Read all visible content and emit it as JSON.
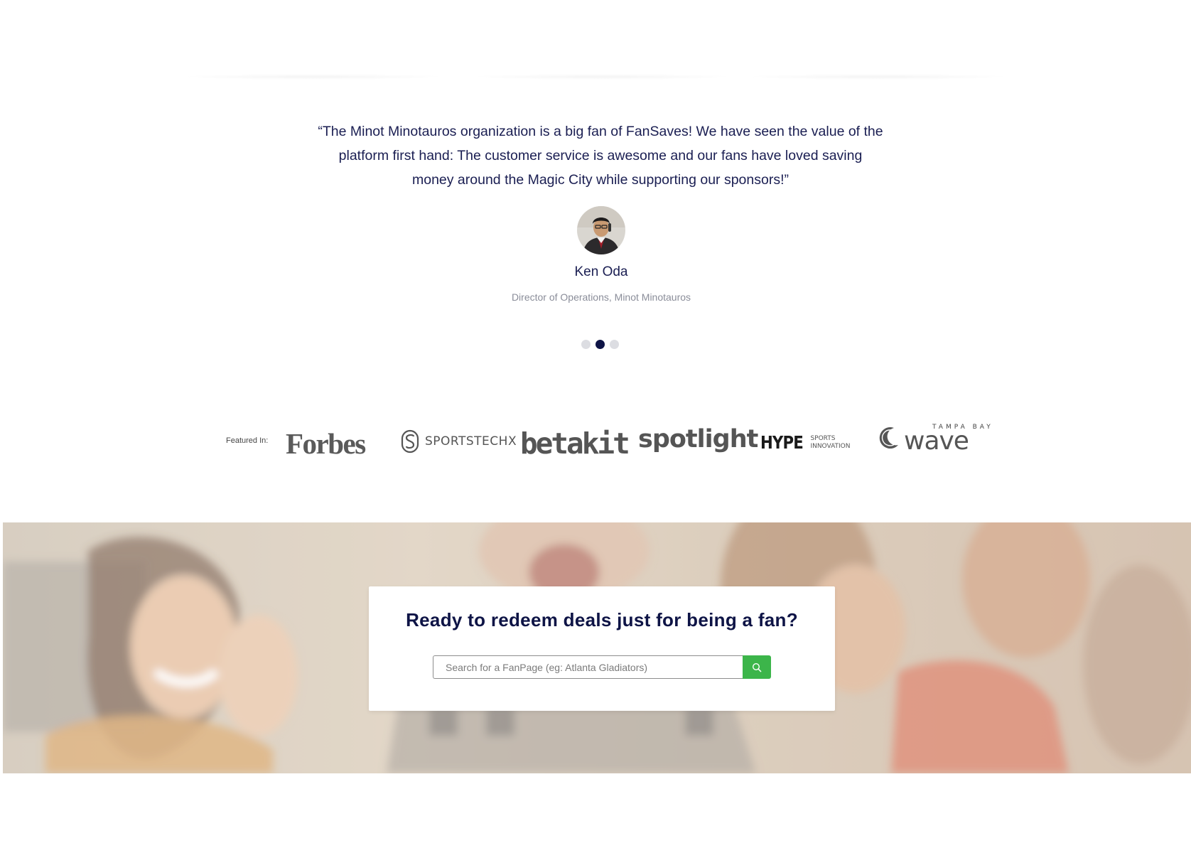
{
  "testimonial": {
    "quote": "“The Minot Minotauros organization is a big fan of FanSaves! We have seen the value of the platform first hand: The customer service is awesome and our fans have loved saving money around the Magic City while supporting our sponsors!”",
    "author_name": "Ken Oda",
    "author_role": "Director of Operations, Minot Minotauros",
    "carousel": {
      "count": 3,
      "active_index": 1
    }
  },
  "featured": {
    "label": "Featured In:",
    "logos": {
      "forbes": "Forbes",
      "sportstechx": "SPORTSTECHX",
      "betakit": "betakit",
      "spotlight": "spotlight",
      "hype_main": "HYPE",
      "hype_sub_1": "SPORTS",
      "hype_sub_2": "INNOVATION",
      "wave_top": "TAMPA BAY",
      "wave_main": "wave"
    }
  },
  "cta": {
    "title": "Ready to redeem deals just for being a fan?",
    "search_placeholder": "Search for a FanPage (eg: Atlanta Gladiators)",
    "search_value": ""
  },
  "colors": {
    "navy": "#0e1446",
    "text": "#1a1e52",
    "muted": "#8a8d99",
    "green": "#3cb54a",
    "dot_inactive": "#dcdde2"
  },
  "icons": [
    "search-icon"
  ]
}
